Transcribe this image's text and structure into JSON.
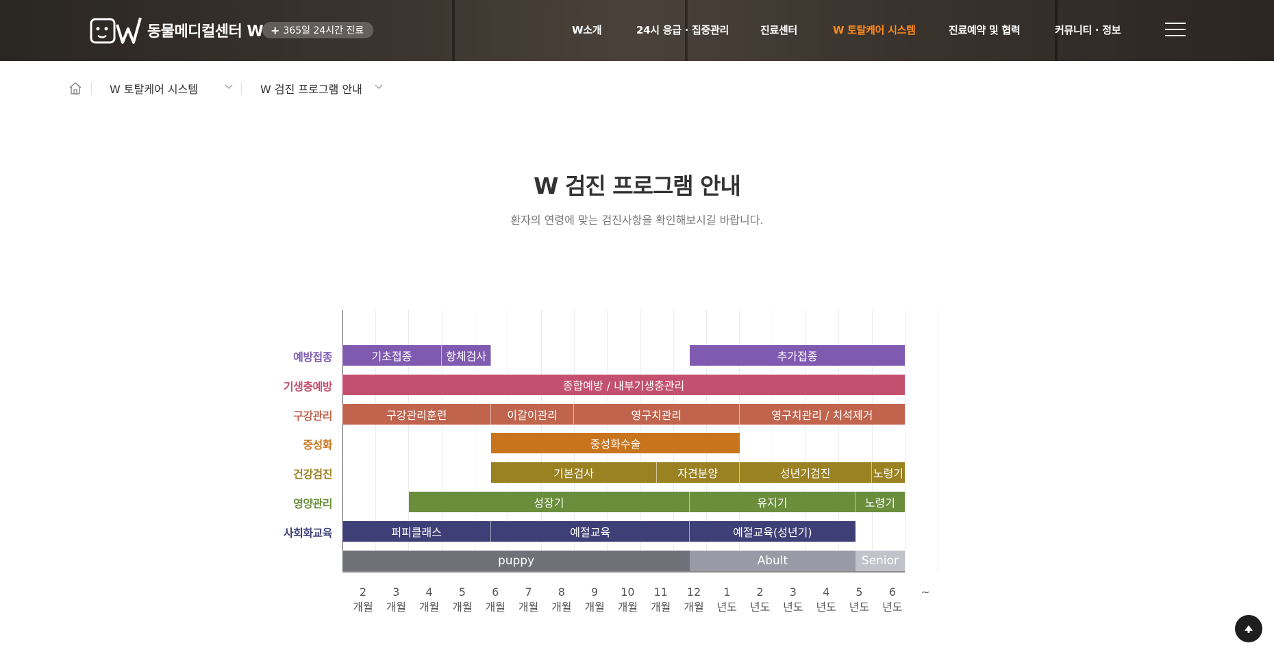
{
  "header": {
    "logo_text": "동물메디컬센터 W",
    "badge_text": "365일 24시간 진료",
    "nav": [
      {
        "label": "W소개",
        "active": false
      },
      {
        "label": "24시 응급 · 집중관리",
        "active": false
      },
      {
        "label": "진료센터",
        "active": false
      },
      {
        "label": "W 토탈케어 시스템",
        "active": true
      },
      {
        "label": "진료예약 및 협력",
        "active": false
      },
      {
        "label": "커뮤니티 · 정보",
        "active": false
      }
    ]
  },
  "breadcrumb": {
    "level1": "W 토탈케어 시스템",
    "level2": "W 검진 프로그램 안내"
  },
  "main": {
    "title": "W 검진 프로그램 안내",
    "subtitle": "환자의 연령에 맞는 검진사항을 확인해보시길 바랍니다."
  },
  "colors": {
    "accent": "#ff8a1e",
    "vaccine": "#7f5ab0",
    "parasite": "#c4506f",
    "dental": "#c0644e",
    "neuter": "#c8741d",
    "checkup": "#9a8121",
    "nutrition": "#6a8e3c",
    "social": "#3d3f76",
    "stage_puppy": "#707079",
    "stage_abult": "#999aa5",
    "stage_senior": "#c1c2ca"
  },
  "chart_data": {
    "type": "gantt",
    "x_ticks": [
      {
        "value": "2",
        "unit": "개월"
      },
      {
        "value": "3",
        "unit": "개월"
      },
      {
        "value": "4",
        "unit": "개월"
      },
      {
        "value": "5",
        "unit": "개월"
      },
      {
        "value": "6",
        "unit": "개월"
      },
      {
        "value": "7",
        "unit": "개월"
      },
      {
        "value": "8",
        "unit": "개월"
      },
      {
        "value": "9",
        "unit": "개월"
      },
      {
        "value": "10",
        "unit": "개월"
      },
      {
        "value": "11",
        "unit": "개월"
      },
      {
        "value": "12",
        "unit": "개월"
      },
      {
        "value": "1",
        "unit": "년도"
      },
      {
        "value": "2",
        "unit": "년도"
      },
      {
        "value": "3",
        "unit": "년도"
      },
      {
        "value": "4",
        "unit": "년도"
      },
      {
        "value": "5",
        "unit": "년도"
      },
      {
        "value": "6",
        "unit": "년도"
      },
      {
        "value": "~",
        "unit": ""
      }
    ],
    "rows": [
      {
        "label": "예방접종",
        "color": "#7f5ab0",
        "segments": [
          {
            "label": "기초접종",
            "start": 2,
            "end": 5
          },
          {
            "label": "항체검사",
            "start": 5,
            "end": 6.5
          },
          {
            "label": "추가접종",
            "start": 12.5,
            "end": 19
          }
        ]
      },
      {
        "label": "기생충예방",
        "color": "#c4506f",
        "segments": [
          {
            "label": "종합예방 / 내부기생충관리",
            "start": 2,
            "end": 19
          }
        ]
      },
      {
        "label": "구강관리",
        "color": "#c0644e",
        "segments": [
          {
            "label": "구강관리훈련",
            "start": 2,
            "end": 6.5
          },
          {
            "label": "이갈이관리",
            "start": 6.5,
            "end": 9
          },
          {
            "label": "영구치관리",
            "start": 9,
            "end": 14
          },
          {
            "label": "영구치관리 / 치석제거",
            "start": 14,
            "end": 19
          }
        ]
      },
      {
        "label": "중성화",
        "color": "#c8741d",
        "segments": [
          {
            "label": "중성화수술",
            "start": 6.5,
            "end": 14
          }
        ]
      },
      {
        "label": "건강검진",
        "color": "#9a8121",
        "segments": [
          {
            "label": "기본검사",
            "start": 6.5,
            "end": 11.5
          },
          {
            "label": "자견분양",
            "start": 11.5,
            "end": 14
          },
          {
            "label": "성년기검진",
            "start": 14,
            "end": 18
          },
          {
            "label": "노령기",
            "start": 18,
            "end": 19
          }
        ]
      },
      {
        "label": "영양관리",
        "color": "#6a8e3c",
        "segments": [
          {
            "label": "성장기",
            "start": 4,
            "end": 12.5
          },
          {
            "label": "유지기",
            "start": 12.5,
            "end": 17.5
          },
          {
            "label": "노령기",
            "start": 17.5,
            "end": 19
          }
        ]
      },
      {
        "label": "사회화교육",
        "color": "#3d3f76",
        "segments": [
          {
            "label": "퍼피클래스",
            "start": 2,
            "end": 6.5
          },
          {
            "label": "예절교육",
            "start": 6.5,
            "end": 12.5
          },
          {
            "label": "예절교육(성년기)",
            "start": 12.5,
            "end": 17.5
          }
        ]
      },
      {
        "label": "",
        "color": "",
        "segments": [
          {
            "label": "puppy",
            "start": 2,
            "end": 12.5,
            "color": "#707079"
          },
          {
            "label": "Abult",
            "start": 12.5,
            "end": 17.5,
            "color": "#999aa5"
          },
          {
            "label": "Senior",
            "start": 17.5,
            "end": 19,
            "color": "#c1c2ca"
          }
        ]
      }
    ],
    "row_label_colors": [
      "#7f5ab0",
      "#c4506f",
      "#c0644e",
      "#c8741d",
      "#9a8121",
      "#6a8e3c",
      "#3d3f76"
    ]
  }
}
